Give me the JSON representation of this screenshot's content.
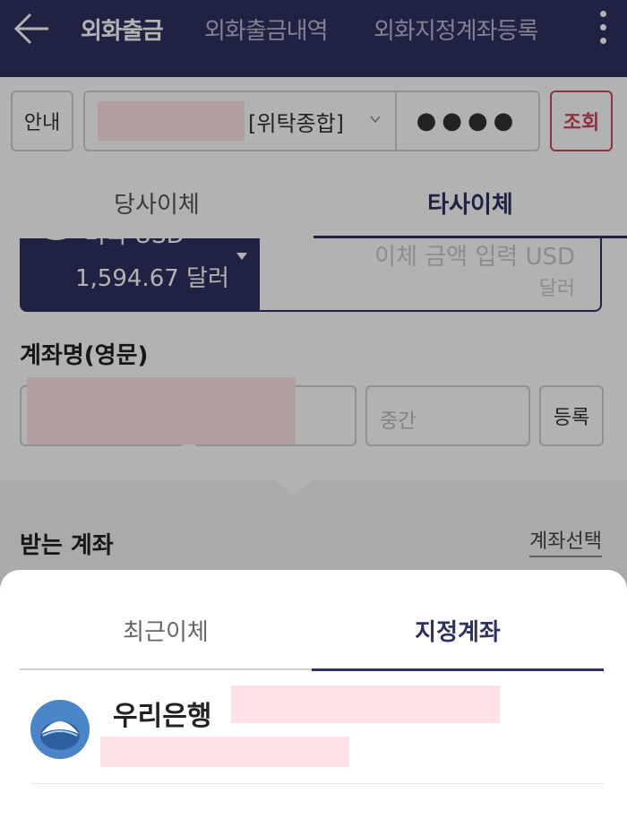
{
  "header": {
    "back_icon": "arrow-left-icon",
    "tabs": [
      {
        "label": "외화출금",
        "active": true
      },
      {
        "label": "외화출금내역",
        "active": false
      },
      {
        "label": "외화지정계좌등록",
        "active": false
      }
    ],
    "menu_icon": "kebab-menu-icon",
    "background": "#2d3261"
  },
  "account_bar": {
    "guide_button": "안내",
    "account_type": "[위탁종합]",
    "password_mask": "●●●●",
    "query_button": "조회"
  },
  "transfer_tabs": {
    "tabs": [
      {
        "label": "당사이체",
        "active": false
      },
      {
        "label": "타사이체",
        "active": true
      }
    ]
  },
  "currency": {
    "name": "미국 USD",
    "balance": "1,594.67 달러",
    "flag_icon": "us-flag-icon"
  },
  "amount": {
    "placeholder": "이체 금액 입력 USD",
    "unit": "달러"
  },
  "account_name": {
    "title": "계좌명(영문)",
    "middle_placeholder": "중간",
    "register_button": "등록"
  },
  "receiving": {
    "title": "받는 계좌",
    "select_link": "계좌선택"
  },
  "sheet": {
    "tabs": [
      {
        "label": "최근이체",
        "active": false
      },
      {
        "label": "지정계좌",
        "active": true
      }
    ],
    "items": [
      {
        "bank": "우리은행",
        "logo_icon": "woori-bank-logo"
      }
    ]
  },
  "colors": {
    "brand": "#2d3261",
    "query_accent": "#c94a5b",
    "redaction": "#fde3e6"
  }
}
